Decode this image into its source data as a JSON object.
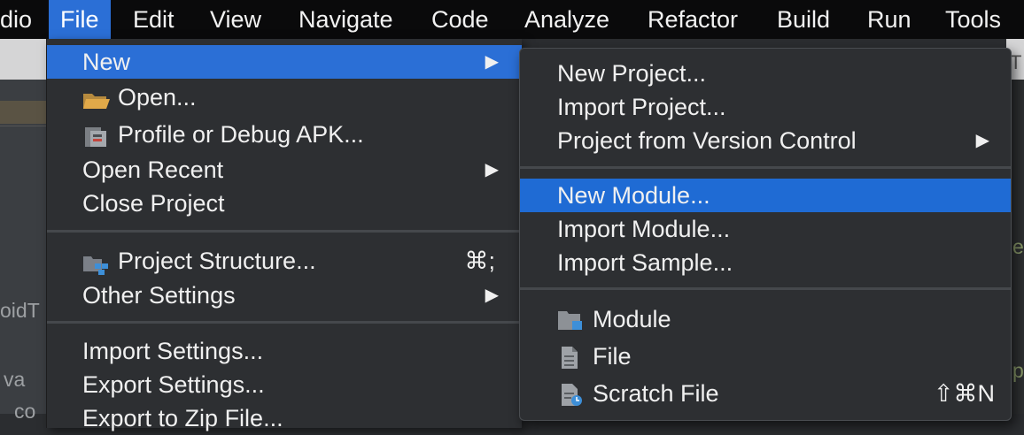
{
  "menubar": {
    "app_fragment": "dio",
    "items": [
      "File",
      "Edit",
      "View",
      "Navigate",
      "Code",
      "Analyze",
      "Refactor",
      "Build",
      "Run",
      "Tools"
    ]
  },
  "background": {
    "frag1": "oidT",
    "frag2": "va",
    "frag3": "co",
    "frag_right1": "e",
    "frag_right2": "p",
    "frag_topright": "T"
  },
  "file_menu": {
    "new": "New",
    "open": "Open...",
    "profile_debug": "Profile or Debug APK...",
    "open_recent": "Open Recent",
    "close_project": "Close Project",
    "project_structure": "Project Structure...",
    "project_structure_shortcut": "⌘;",
    "other_settings": "Other Settings",
    "import_settings": "Import Settings...",
    "export_settings": "Export Settings...",
    "export_zip": "Export to Zip File..."
  },
  "new_submenu": {
    "new_project": "New Project...",
    "import_project": "Import Project...",
    "project_from_vcs": "Project from Version Control",
    "new_module": "New Module...",
    "import_module": "Import Module...",
    "import_sample": "Import Sample...",
    "module": "Module",
    "file": "File",
    "scratch_file": "Scratch File",
    "scratch_shortcut": "⇧⌘N"
  },
  "colors": {
    "highlight": "#2b6fd6",
    "menu_bg": "#2d2f32",
    "menubar_bg": "#0a0a0b"
  }
}
